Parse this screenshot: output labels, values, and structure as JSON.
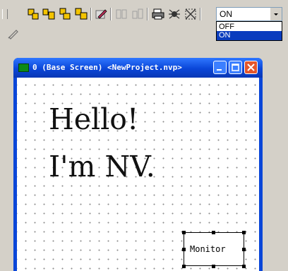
{
  "toolbar": {
    "icons": [
      "align-icon",
      "group-icon",
      "layer-icon",
      "copy-icon",
      "edit-icon",
      "disabled-icon",
      "disabled-icon",
      "print-icon",
      "bug-icon",
      "grid-icon"
    ],
    "row2_icon": "pen-icon"
  },
  "state_dropdown": {
    "selected": "ON",
    "options": [
      "OFF",
      "ON"
    ]
  },
  "screen_window": {
    "title": "0 (Base Screen) <NewProject.nvp>",
    "controls": [
      "minimize",
      "maximize",
      "close"
    ]
  },
  "canvas": {
    "line1": "Hello!",
    "line2": "I'm NV.",
    "monitor_label": "Monitor"
  },
  "colors": {
    "titlebar": "#0a46d8",
    "selection": "#0a3cbe",
    "close_button": "#e4562b"
  }
}
